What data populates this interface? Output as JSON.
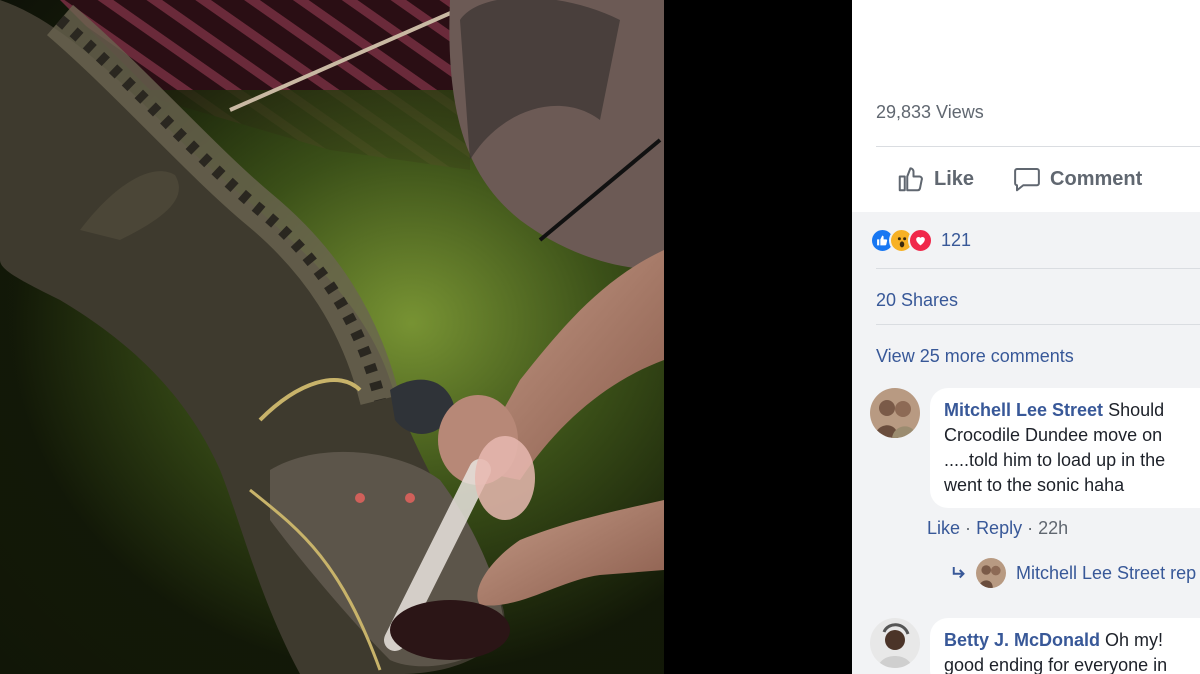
{
  "post": {
    "views": "29,833 Views",
    "actions": {
      "like": "Like",
      "comment": "Comment"
    },
    "reaction_count": "121",
    "shares": "20 Shares",
    "view_more_comments": "View 25 more comments"
  },
  "comments": [
    {
      "author": "Mitchell Lee Street",
      "text": "Should",
      "lines": [
        "Crocodile Dundee move on",
        ".....told him to load up in the",
        "went to the sonic haha"
      ],
      "like": "Like",
      "reply": "Reply",
      "sep": "·",
      "time": "22h",
      "reply_preview": "Mitchell Lee Street rep"
    },
    {
      "author": "Betty J. McDonald",
      "text": "Oh my!",
      "lines": [
        "good ending for everyone in"
      ]
    }
  ],
  "icons": {
    "like": "thumbs-up-icon",
    "comment": "speech-bubble-icon",
    "reply_arrow": "reply-arrow-icon",
    "reactions": [
      "like-reaction-icon",
      "wow-reaction-icon",
      "love-reaction-icon"
    ]
  },
  "colors": {
    "link_blue": "#385898",
    "muted_text": "#606770",
    "like_reaction": "#1877f2",
    "wow_reaction": "#f7b125",
    "love_reaction": "#f0284a"
  }
}
